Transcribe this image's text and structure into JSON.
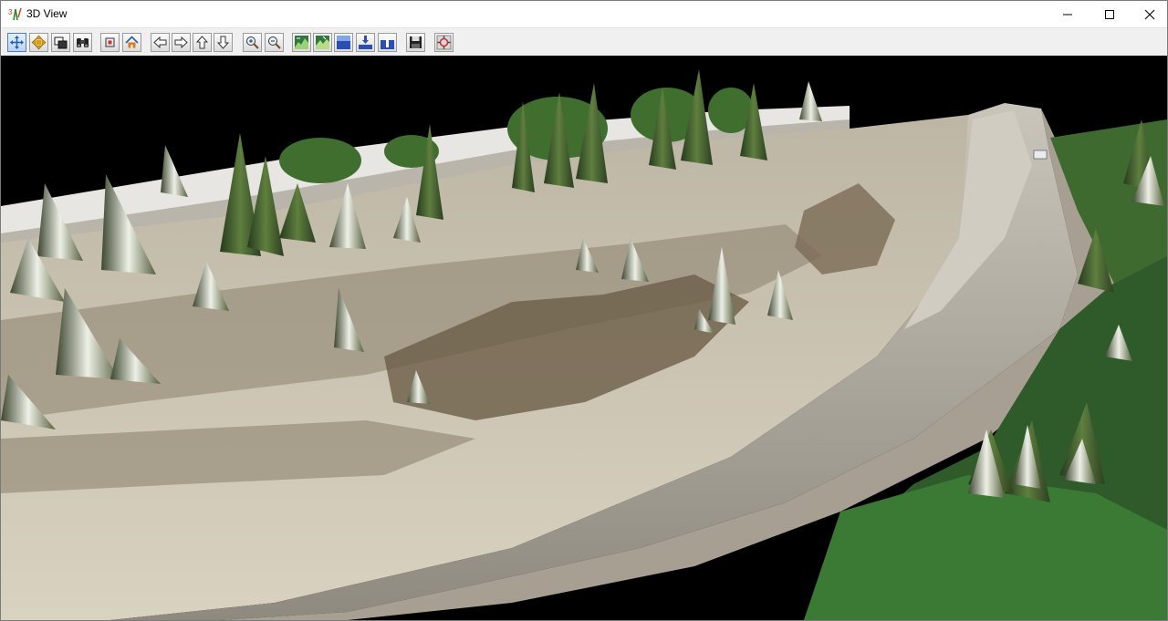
{
  "window": {
    "title": "3D View",
    "controls": [
      "minimize-icon",
      "maximize-icon",
      "close-icon"
    ]
  },
  "toolbar": {
    "tools": [
      {
        "name": "rotate-tool-button",
        "icon": "rotate-arrows-icon",
        "active": true
      },
      {
        "name": "pan-tool-button",
        "icon": "pan-arrows-icon"
      },
      {
        "name": "layers-button",
        "icon": "layers-icon"
      },
      {
        "name": "binoculars-button",
        "icon": "binoculars-icon"
      },
      {
        "name": "fit-view-button",
        "icon": "fit-view-icon"
      },
      {
        "name": "home-view-button",
        "icon": "home-icon"
      },
      {
        "name": "move-left-button",
        "icon": "arrow-left-icon"
      },
      {
        "name": "move-right-button",
        "icon": "arrow-right-icon"
      },
      {
        "name": "move-up-button",
        "icon": "arrow-up-icon"
      },
      {
        "name": "move-down-button",
        "icon": "arrow-down-icon"
      },
      {
        "name": "zoom-in-button",
        "icon": "zoom-in-icon"
      },
      {
        "name": "zoom-out-button",
        "icon": "zoom-out-icon"
      },
      {
        "name": "surface-view-1-button",
        "icon": "terrain-icon"
      },
      {
        "name": "surface-view-2-button",
        "icon": "terrain-icon"
      },
      {
        "name": "water-surface-button",
        "icon": "water-icon"
      },
      {
        "name": "lower-surface-button",
        "icon": "surface-down-icon"
      },
      {
        "name": "raise-surface-button",
        "icon": "surface-up-icon"
      },
      {
        "name": "save-button",
        "icon": "floppy-disk-icon"
      },
      {
        "name": "settings-button",
        "icon": "settings-icon"
      }
    ]
  },
  "viewport": {
    "content": "3d-terrain-point-cloud",
    "sky_color": "#000000"
  }
}
